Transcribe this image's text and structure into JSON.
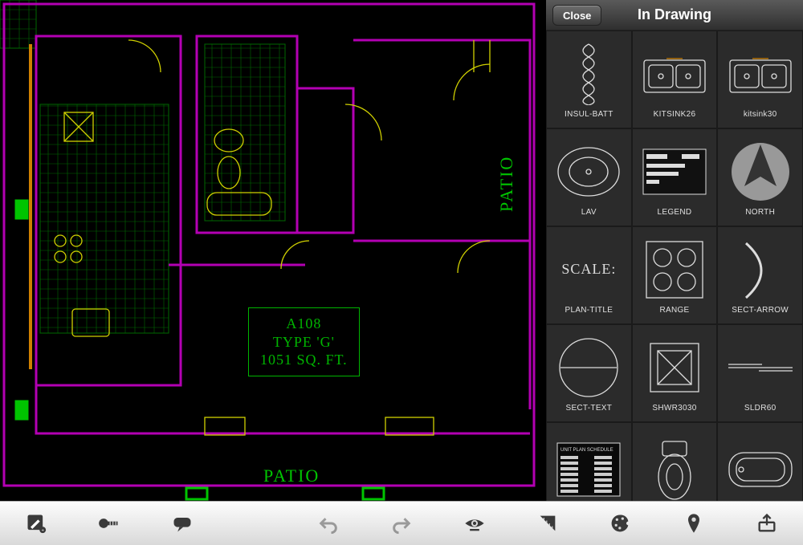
{
  "panel": {
    "close_label": "Close",
    "title": "In Drawing"
  },
  "blocks": [
    {
      "label": "INSUL-BATT",
      "icon": "insul"
    },
    {
      "label": "KITSINK26",
      "icon": "kitsink2"
    },
    {
      "label": "kitsink30",
      "icon": "kitsink2"
    },
    {
      "label": "LAV",
      "icon": "lav"
    },
    {
      "label": "LEGEND",
      "icon": "legend"
    },
    {
      "label": "NORTH",
      "icon": "north"
    },
    {
      "label": "PLAN-TITLE",
      "icon": "scale"
    },
    {
      "label": "RANGE",
      "icon": "range"
    },
    {
      "label": "SECT-ARROW",
      "icon": "sectarrow"
    },
    {
      "label": "SECT-TEXT",
      "icon": "secttext"
    },
    {
      "label": "SHWR3030",
      "icon": "shwr"
    },
    {
      "label": "SLDR60",
      "icon": "sldr"
    },
    {
      "label": "",
      "icon": "schedule"
    },
    {
      "label": "",
      "icon": "toilet"
    },
    {
      "label": "",
      "icon": "tub"
    }
  ],
  "plan": {
    "line1": "A108",
    "line2": "TYPE 'G'",
    "line3": "1051 SQ. FT.",
    "patio": "PATIO"
  },
  "scale_label": "SCALE:",
  "toolbar_icons": [
    "pencil",
    "measure",
    "note",
    "layers",
    "undo",
    "redo",
    "view",
    "snap",
    "color",
    "marker",
    "share"
  ]
}
